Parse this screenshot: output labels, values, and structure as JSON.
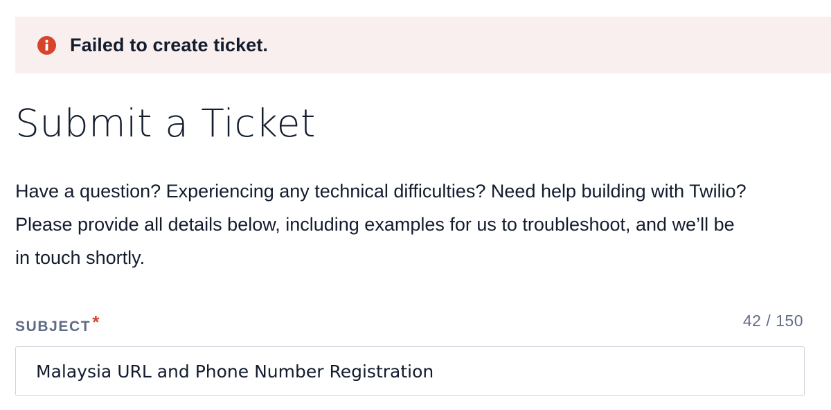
{
  "alert": {
    "icon": "error-icon",
    "color": "#d6442c",
    "background": "#f9efee",
    "message": "Failed to create ticket."
  },
  "page": {
    "title": "Submit a Ticket",
    "intro_lines": [
      "Have a question? Experiencing any technical difficulties? Need help building with Twilio?",
      "Please provide all details below, including examples for us to troubleshoot, and we’ll be",
      "in touch shortly."
    ]
  },
  "subject": {
    "label": "SUBJECT",
    "required_mark": "*",
    "counter": "42 / 150",
    "value": "Malaysia URL and Phone Number Registration"
  }
}
